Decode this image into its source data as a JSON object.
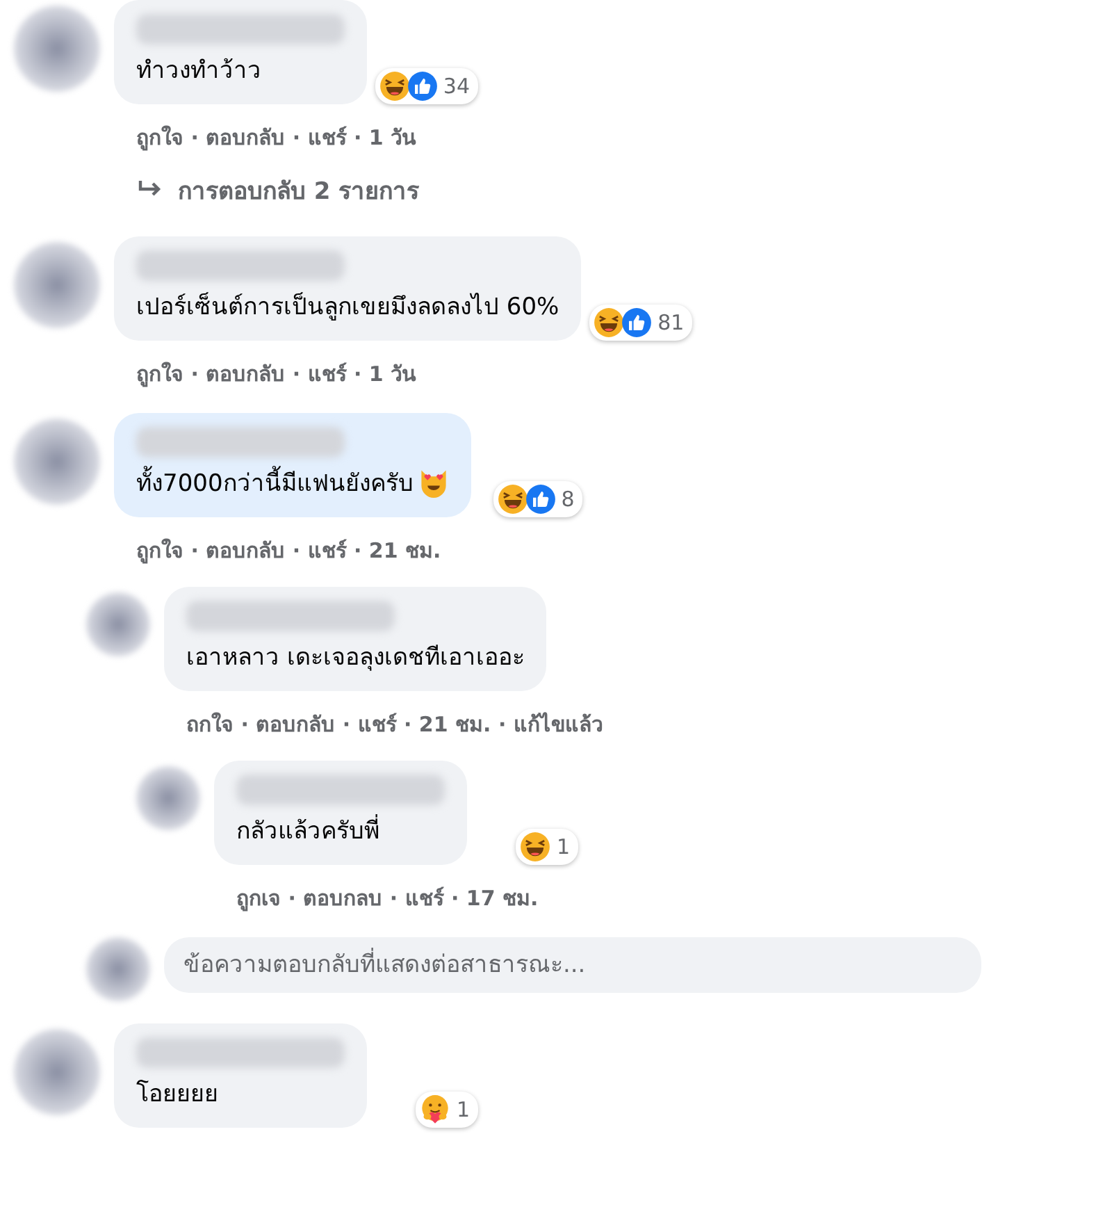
{
  "comments": [
    {
      "text": "ทำวงทำว้าว",
      "highlighted": false,
      "reactions": [
        {
          "kind": "haha"
        },
        {
          "kind": "like"
        }
      ],
      "reaction_count": "34",
      "meta": "ถูกใจ · ตอบกลับ · แชร์ · 1 วัน",
      "replies_link": "การตอบกลับ 2 รายการ"
    },
    {
      "text": "เปอร์เซ็นต์การเป็นลูกเขยมึงลดลงไป 60%",
      "highlighted": false,
      "reactions": [
        {
          "kind": "haha"
        },
        {
          "kind": "like"
        }
      ],
      "reaction_count": "81",
      "meta": "ถูกใจ · ตอบกลับ · แชร์ · 1 วัน"
    },
    {
      "text": "ทั้ง7000กว่านี้มีแฟนยังครับ",
      "emoji": {
        "kind": "heart-eyes"
      },
      "highlighted": true,
      "reactions": [
        {
          "kind": "haha"
        },
        {
          "kind": "like"
        }
      ],
      "reaction_count": "8",
      "meta": "ถูกใจ · ตอบกลับ · แชร์ · 21 ชม.",
      "children": [
        {
          "text": "เอาหลาว เดะเจอลุงเดชทีเอาเออะ",
          "highlighted": false,
          "meta": "ถกใจ · ตอบกลับ · แชร์ · 21 ชม. · แก้ไขแล้ว",
          "children": [
            {
              "text": "กลัวแล้วครับพี่",
              "highlighted": false,
              "reactions": [
                {
                  "kind": "haha"
                }
              ],
              "reaction_count": "1",
              "meta": "ถูกเจ · ตอบกลบ · แชร์ · 17 ชม."
            }
          ]
        }
      ],
      "reply_box": {
        "placeholder": "ข้อความตอบกลับที่แสดงต่อสาธารณะ..."
      }
    },
    {
      "text": "โอยยยย",
      "highlighted": false,
      "reactions": [
        {
          "kind": "care"
        }
      ],
      "reaction_count": "1"
    }
  ]
}
